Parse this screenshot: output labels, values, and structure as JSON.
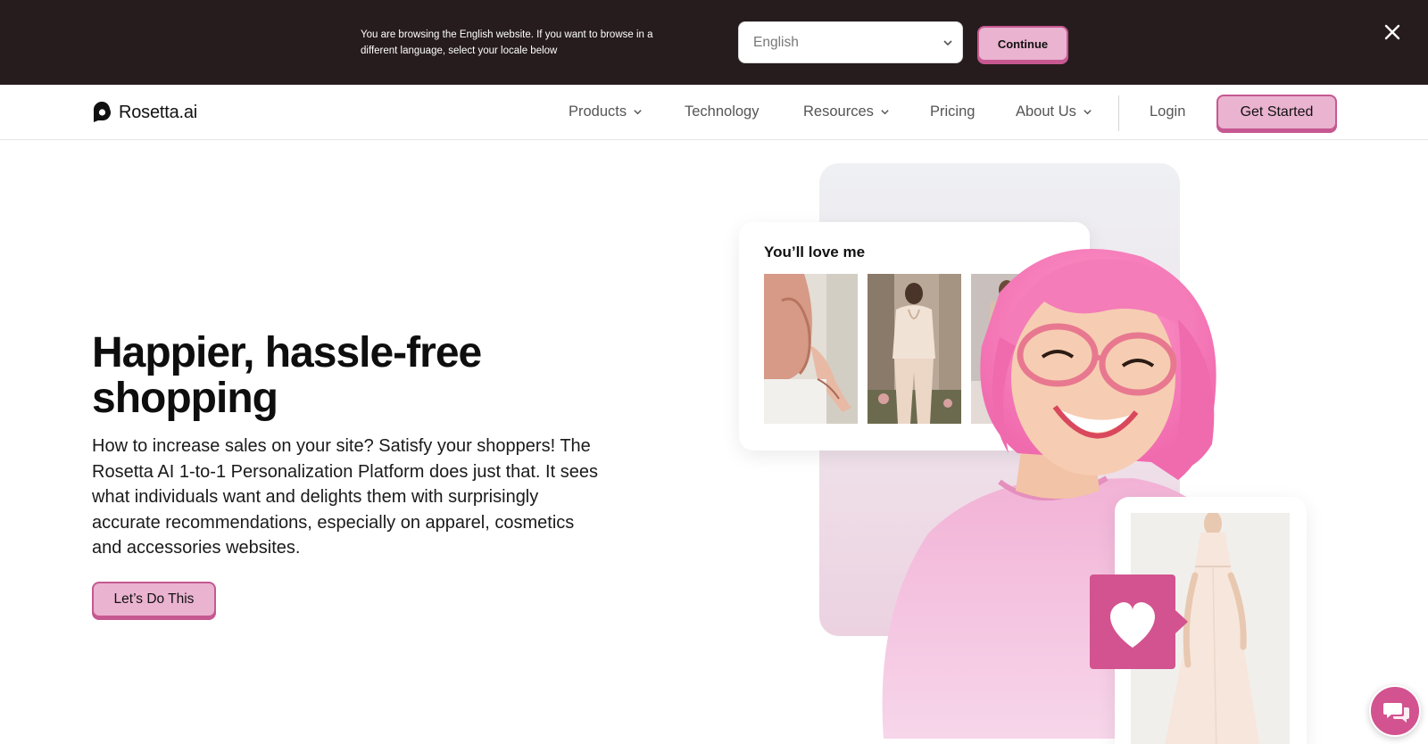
{
  "locale_banner": {
    "message": "You are browsing the English website. If you want to browse in a different language, select your locale below",
    "select_value": "English",
    "continue_label": "Continue"
  },
  "nav": {
    "logo_text": "Rosetta.ai",
    "items": [
      {
        "label": "Products",
        "dropdown": true
      },
      {
        "label": "Technology",
        "dropdown": false
      },
      {
        "label": "Resources",
        "dropdown": true
      },
      {
        "label": "Pricing",
        "dropdown": false
      },
      {
        "label": "About Us",
        "dropdown": true
      }
    ],
    "login_label": "Login",
    "cta_label": "Get Started"
  },
  "hero": {
    "title": "Happier, hassle-free shopping",
    "description": "How to increase sales on your site? Satisfy your shoppers! The Rosetta AI 1-to-1 Personalization Platform does just that. It sees what individuals want and delights them with surprisingly accurate recommendations, especially on apparel, cosmetics and accessories websites.",
    "cta_label": "Let’s Do This"
  },
  "recommendation_card": {
    "title": "You’ll love me"
  },
  "colors": {
    "banner_bg": "#261c1d",
    "accent_pink": "#eab3d0",
    "accent_border": "#c65891",
    "heart_badge": "#d2538f"
  },
  "icons": {
    "close": "close-icon",
    "chevron": "chevron-down-icon",
    "heart": "heart-icon",
    "chat": "chat-icon"
  }
}
